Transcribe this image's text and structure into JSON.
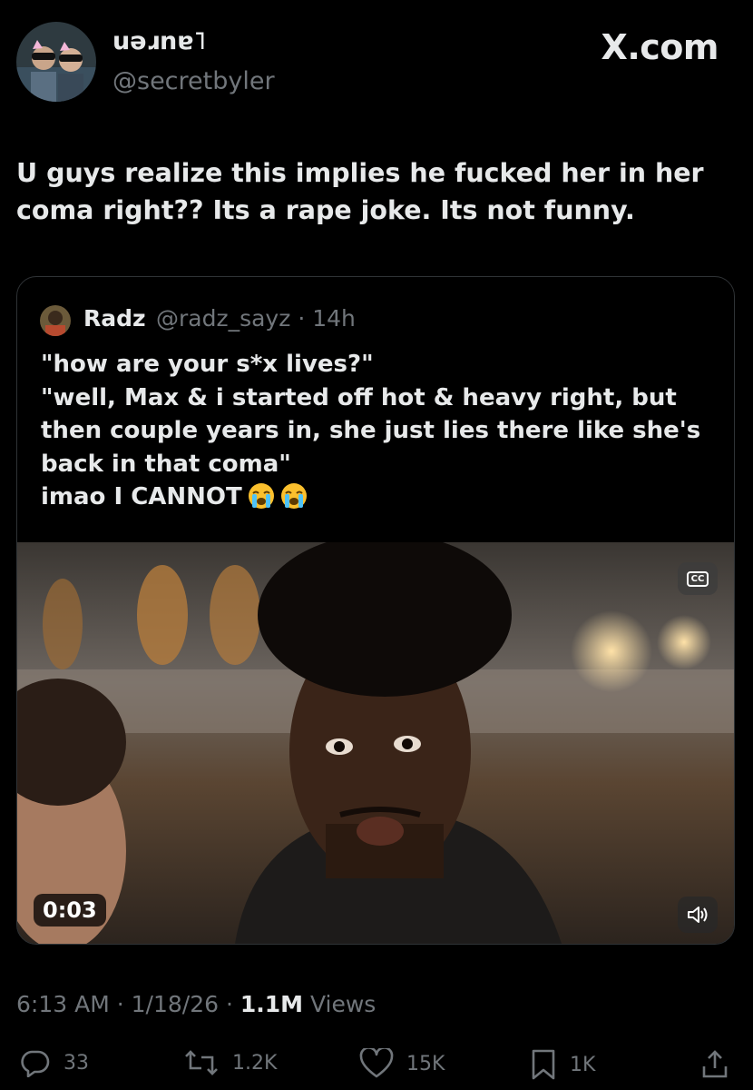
{
  "header": {
    "display_name": "uǝɹnɐ˥",
    "handle": "@secretbyler",
    "brand": "X.com",
    "avatar_icon": "profile-photo"
  },
  "tweet": {
    "text": "U guys realize this implies he fucked her in her coma right?? Its a rape joke. Its not funny."
  },
  "quote": {
    "name": "Radz",
    "handle": "@radz_sayz",
    "separator": "·",
    "time": "14h",
    "text": "\"how are your s*x lives?\"\n\"well, Max & i started off hot & heavy right, but then couple years in, she just lies there like she's back in that coma\"\nimao I CANNOT",
    "emojis": [
      "loudly-crying-face",
      "loudly-crying-face"
    ],
    "video": {
      "cc_label": "CC",
      "timer": "0:03",
      "volume_icon": "volume-icon"
    }
  },
  "meta": {
    "time": "6:13 AM",
    "dot1": "·",
    "date": "1/18/26",
    "dot2": "·",
    "views_count": "1.1M",
    "views_label": "Views"
  },
  "actions": {
    "replies": "33",
    "reposts": "1.2K",
    "likes": "15K",
    "bookmarks": "1K"
  },
  "colors": {
    "background": "#000000",
    "text": "#e7e9ea",
    "muted": "#71767b",
    "border": "#2f3336"
  }
}
